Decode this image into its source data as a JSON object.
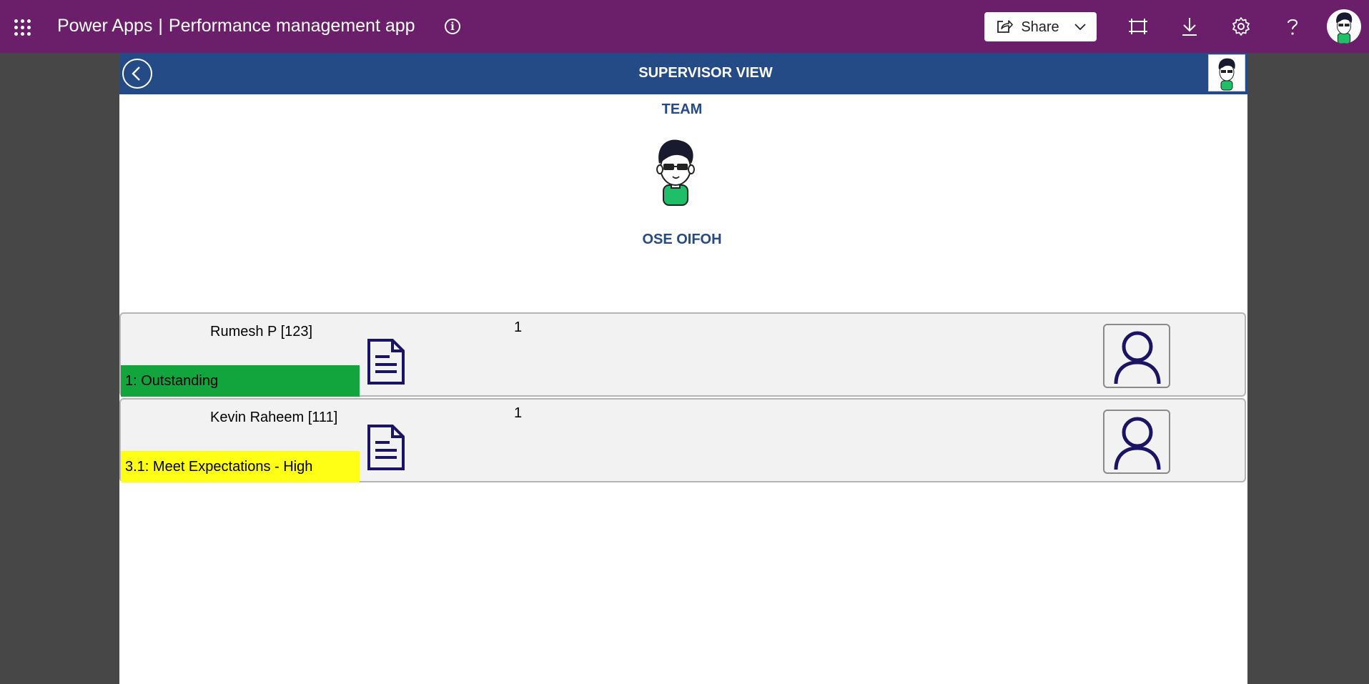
{
  "topbar": {
    "app_name": "Power Apps",
    "separator": "|",
    "app_title": "Performance management app",
    "share_label": "Share",
    "icons": [
      "waffle-icon",
      "info-icon",
      "share-icon",
      "chevron-down-icon",
      "fit-to-window-icon",
      "download-icon",
      "settings-icon",
      "help-icon",
      "user-avatar"
    ],
    "bg_color": "#6b1f6b"
  },
  "screen": {
    "title": "SUPERVISOR VIEW",
    "header_color": "#254b86",
    "section_label": "TEAM",
    "supervisor_name": "OSE OIFOH"
  },
  "employees": [
    {
      "name": "Rumesh P [123]",
      "count": "1",
      "rating": "1: Outstanding",
      "rating_color": "#12a53e"
    },
    {
      "name": "Kevin Raheem [111]",
      "count": "1",
      "rating": "3.1: Meet Expectations - High",
      "rating_color": "#ffff16"
    }
  ]
}
